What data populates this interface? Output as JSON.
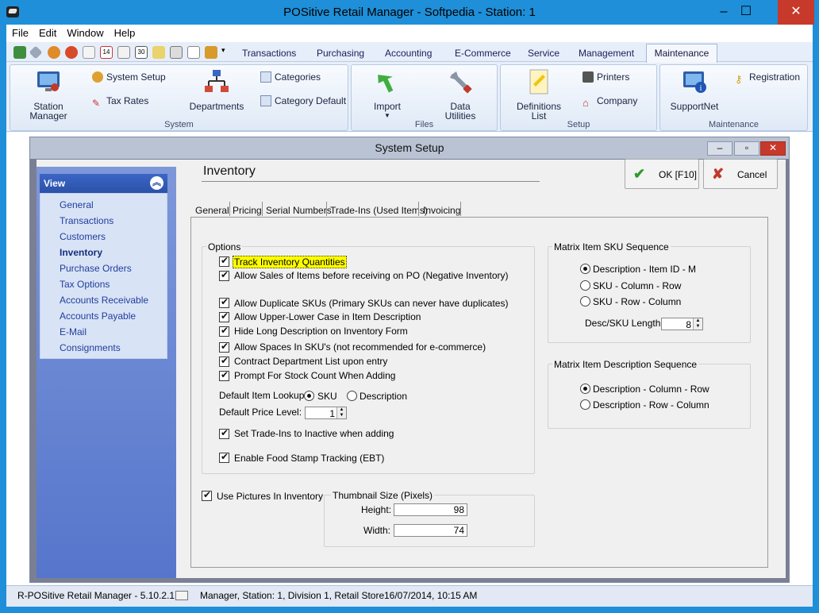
{
  "window": {
    "title": "POSitive Retail Manager - Softpedia - Station: 1"
  },
  "menu": [
    "File",
    "Edit",
    "Window",
    "Help"
  ],
  "ribbon_tabs": [
    "Transactions",
    "Purchasing",
    "Accounting",
    "E-Commerce",
    "Service",
    "Management",
    "Maintenance"
  ],
  "ribbon": {
    "station_manager": "Station\nManager",
    "system_setup": "System Setup",
    "tax_rates": "Tax Rates",
    "departments": "Departments",
    "categories": "Categories",
    "category_default": "Category Default",
    "import": "Import",
    "data_utilities": "Data\nUtilities",
    "definitions_list": "Definitions\nList",
    "printers": "Printers",
    "company": "Company",
    "supportnet": "SupportNet",
    "registration": "Registration",
    "groups": {
      "system": "System",
      "files": "Files",
      "setup": "Setup",
      "maintenance": "Maintenance"
    }
  },
  "dialog": {
    "title": "System Setup",
    "page_title": "Inventory",
    "ok": "OK [F10]",
    "cancel": "Cancel",
    "view_header": "View",
    "view_items": [
      "General",
      "Transactions",
      "Customers",
      "Inventory",
      "Purchase Orders",
      "Tax Options",
      "Accounts Receivable",
      "Accounts Payable",
      "E-Mail",
      "Consignments"
    ],
    "active_view": "Inventory",
    "tabs": [
      "General",
      "Pricing",
      "Serial Numbers",
      "Trade-Ins (Used Items)",
      "Invoicing"
    ],
    "options": {
      "title": "Options",
      "track_inventory": "Track Inventory Quantities",
      "allow_sales": "Allow Sales of Items before receiving on PO (Negative Inventory)",
      "allow_duplicate": "Allow Duplicate SKUs (Primary SKUs can never have duplicates)",
      "allow_case": "Allow Upper-Lower Case in Item Description",
      "hide_long": "Hide Long Description on Inventory Form",
      "allow_spaces": "Allow Spaces In SKU's (not recommended for e-commerce)",
      "contract_dept": "Contract Department List upon entry",
      "prompt_stock": "Prompt For Stock Count When Adding",
      "default_lookup_label": "Default Item Lookup:",
      "lookup_sku": "SKU",
      "lookup_desc": "Description",
      "default_price_label": "Default Price Level:",
      "default_price_value": "1",
      "trade_ins_inactive": "Set Trade-Ins to Inactive when adding",
      "food_stamp": "Enable Food Stamp Tracking (EBT)"
    },
    "pictures": {
      "use_pictures": "Use Pictures In Inventory",
      "thumb_title": "Thumbnail Size (Pixels)",
      "height_label": "Height:",
      "height_value": "98",
      "width_label": "Width:",
      "width_value": "74"
    },
    "matrix_sku": {
      "title": "Matrix Item SKU Sequence",
      "opt1": "Description - Item ID - M",
      "opt2": "SKU - Column - Row",
      "opt3": "SKU - Row - Column",
      "len_label": "Desc/SKU Length:",
      "len_value": "8"
    },
    "matrix_desc": {
      "title": "Matrix Item Description Sequence",
      "opt1": "Description - Column - Row",
      "opt2": "Description - Row - Column"
    }
  },
  "status": {
    "app": "R-POSitive Retail Manager - 5.10.2.1",
    "info": "Manager, Station: 1, Division 1, Retail Store",
    "datetime": "16/07/2014, 10:15 AM"
  }
}
